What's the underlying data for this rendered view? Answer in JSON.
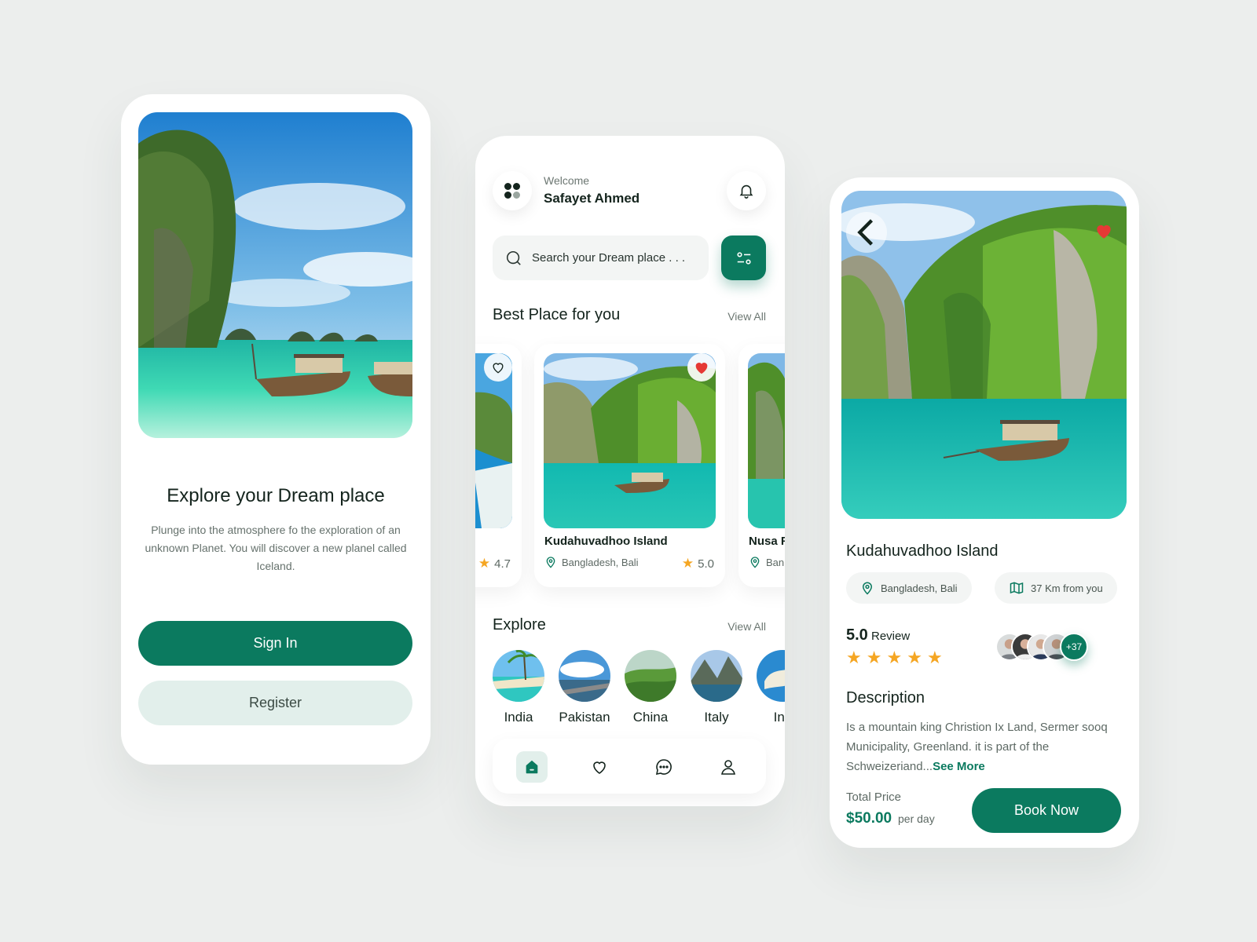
{
  "colors": {
    "accent": "#0b7a5f",
    "accent_light": "#e2efeb",
    "star": "#f5a623",
    "heart": "#e53935",
    "background": "#eceeed"
  },
  "onboarding": {
    "title": "Explore your Dream place",
    "description": "Plunge into the atmosphere fo the exploration of an unknown Planet. You will discover a new planel called Iceland.",
    "sign_in_label": "Sign In",
    "register_label": "Register"
  },
  "home": {
    "welcome_label": "Welcome",
    "user_name": "Safayet Ahmed",
    "search_placeholder": "Search your Dream place . . .",
    "best_place_title": "Best Place for you",
    "best_place_view_all": "View All",
    "cards": [
      {
        "name": "",
        "location": "",
        "rating": "4.7",
        "favorited": false
      },
      {
        "name": "Kudahuvadhoo Island",
        "location": "Bangladesh, Bali",
        "rating": "5.0",
        "favorited": true
      },
      {
        "name": "Nusa F",
        "location": "Ban",
        "rating": "",
        "favorited": false
      }
    ],
    "explore_title": "Explore",
    "explore_view_all": "View All",
    "countries": [
      "India",
      "Pakistan",
      "China",
      "Italy",
      "Inc"
    ],
    "tabs": [
      "home-icon",
      "heart-icon",
      "chat-icon",
      "profile-icon"
    ]
  },
  "detail": {
    "name": "Kudahuvadhoo Island",
    "location": "Bangladesh, Bali",
    "distance": "37 Km from you",
    "rating": "5.0",
    "review_label": "Review",
    "stars": 5,
    "reviewers_more": "+37",
    "description_title": "Description",
    "description": "Is a mountain king Christion Ix Land, Sermer sooq Municipality, Greenland. it is part of the Schweizeriand...",
    "see_more": "See More",
    "price_label": "Total Price",
    "price": "$50.00",
    "price_unit": "per day",
    "book_label": "Book Now"
  }
}
